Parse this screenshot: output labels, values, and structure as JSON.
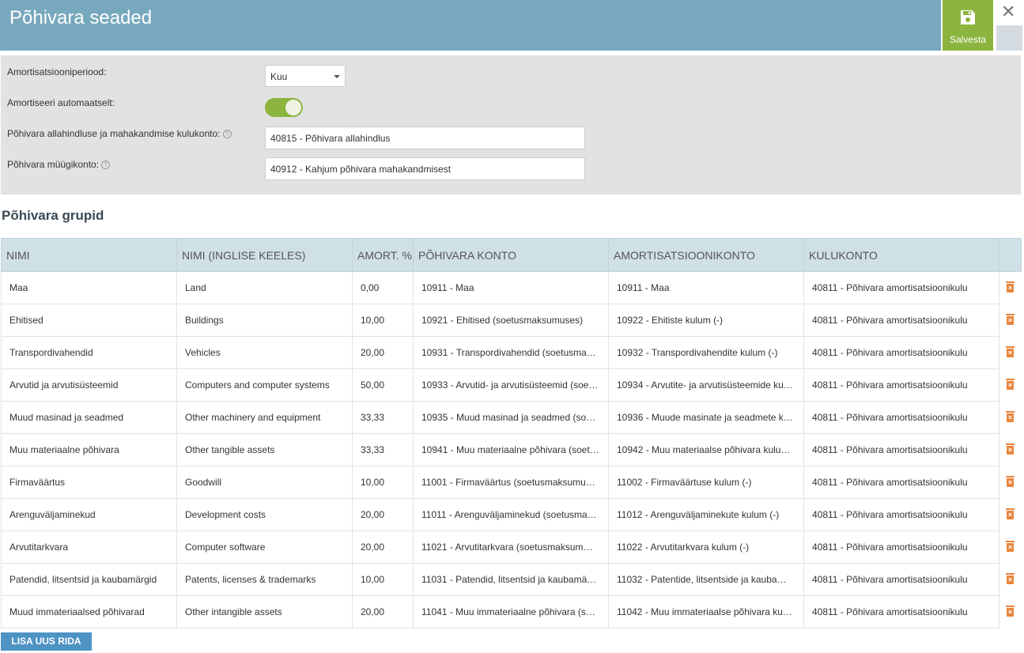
{
  "header": {
    "title": "Põhivara seaded",
    "save_label": "Salvesta",
    "close_glyph": "✕"
  },
  "settings": {
    "period_label": "Amortisatsiooniperiood:",
    "period_value": "Kuu",
    "auto_label": "Amortiseeri automaatselt:",
    "auto_enabled": true,
    "writedown_label": "Põhivara allahindluse ja mahakandmise kulukonto:",
    "writedown_value": "40815 - Põhivara allahindlus",
    "sale_label": "Põhivara müügikonto:",
    "sale_value": "40912 - Kahjum põhivara mahakandmisest",
    "help_glyph": "?"
  },
  "groups": {
    "title": "Põhivara grupid",
    "columns": [
      "NIMI",
      "NIMI (INGLISE KEELES)",
      "AMORT. %",
      "PÕHIVARA KONTO",
      "AMORTISATSIOONIKONTO",
      "KULUKONTO"
    ],
    "rows": [
      [
        "Maa",
        "Land",
        "0,00",
        "10911 - Maa",
        "10911 - Maa",
        "40811 - Põhivara amortisatsioonikulu"
      ],
      [
        "Ehitised",
        "Buildings",
        "10,00",
        "10921 - Ehitised (soetusmaksumuses)",
        "10922 - Ehitiste kulum (-)",
        "40811 - Põhivara amortisatsioonikulu"
      ],
      [
        "Transpordivahendid",
        "Vehicles",
        "20,00",
        "10931 - Transpordivahendid (soetusma…",
        "10932 - Transpordivahendite kulum (-)",
        "40811 - Põhivara amortisatsioonikulu"
      ],
      [
        "Arvutid ja arvutisüsteemid",
        "Computers and computer systems",
        "50,00",
        "10933 - Arvutid- ja arvutisüsteemid (soe…",
        "10934 - Arvutite- ja arvutisüsteemide ku…",
        "40811 - Põhivara amortisatsioonikulu"
      ],
      [
        "Muud masinad ja seadmed",
        "Other machinery and equipment",
        "33,33",
        "10935 - Muud masinad ja seadmed (so…",
        "10936 - Muude masinate ja seadmete k…",
        "40811 - Põhivara amortisatsioonikulu"
      ],
      [
        "Muu materiaalne põhivara",
        "Other tangible assets",
        "33,33",
        "10941 - Muu materiaalne põhivara (soet…",
        "10942 - Muu materiaalse põhivara kulu…",
        "40811 - Põhivara amortisatsioonikulu"
      ],
      [
        "Firmaväärtus",
        "Goodwill",
        "10,00",
        "11001 - Firmaväärtus (soetusmaksumu…",
        "11002 - Firmaväärtuse kulum (-)",
        "40811 - Põhivara amortisatsioonikulu"
      ],
      [
        "Arenguväljaminekud",
        "Development costs",
        "20,00",
        "11011 - Arenguväljaminekud (soetusma…",
        "11012 - Arenguväljaminekute kulum (-)",
        "40811 - Põhivara amortisatsioonikulu"
      ],
      [
        "Arvutitarkvara",
        "Computer software",
        "20,00",
        "11021 - Arvutitarkvara (soetusmaksum…",
        "11022 - Arvutitarkvara kulum (-)",
        "40811 - Põhivara amortisatsioonikulu"
      ],
      [
        "Patendid, litsentsid ja kaubamärgid",
        "Patents, licenses & trademarks",
        "10,00",
        "11031 - Patendid, litsentsid ja kaubamä…",
        "11032 - Patentide, litsentside ja kauba…",
        "40811 - Põhivara amortisatsioonikulu"
      ],
      [
        "Muud immateriaalsed põhivarad",
        "Other intangible assets",
        "20,00",
        "11041 - Muu immateriaalne põhivara (s…",
        "11042 - Muu immateriaalse põhivara ku…",
        "40811 - Põhivara amortisatsioonikulu"
      ]
    ],
    "add_label": "LISA UUS RIDA"
  },
  "icons": {
    "save": "floppy-disk-icon",
    "close": "close-icon",
    "delete": "trash-icon",
    "dropdown": "chevron-down-icon",
    "help": "help-circle-icon"
  },
  "colors": {
    "header": "#77a8bd",
    "save": "#8cb43f",
    "toggle": "#8cb43f",
    "delete": "#e8853b",
    "add_button": "#4d93c4",
    "table_header": "#d0e0e7"
  }
}
